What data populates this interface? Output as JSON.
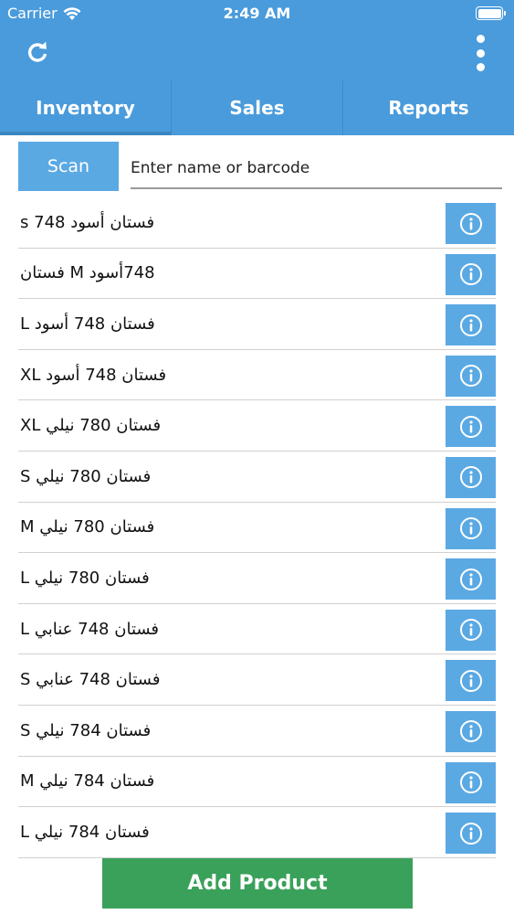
{
  "status_bar": {
    "carrier": "Carrier",
    "time": "2:49 AM"
  },
  "toolbar": {
    "refresh_icon": "refresh-icon",
    "menu_icon": "more-vertical-icon"
  },
  "tabs": [
    {
      "label": "Inventory",
      "active": true
    },
    {
      "label": "Sales",
      "active": false
    },
    {
      "label": "Reports",
      "active": false
    }
  ],
  "search": {
    "scan_label": "Scan",
    "placeholder": "Enter name or barcode",
    "value": ""
  },
  "products": [
    {
      "label": "فستان  أسود  748 s"
    },
    {
      "label": "748أسود  M فستان"
    },
    {
      "label": "فستان 748 أسود L"
    },
    {
      "label": "فستان 748 أسود  XL"
    },
    {
      "label": "فستان 780 نيلي  XL"
    },
    {
      "label": "فستان 780 نيلي  S"
    },
    {
      "label": "فستان 780 نيلي  M"
    },
    {
      "label": "فستان 780 نيلي  L"
    },
    {
      "label": "فستان 748 عنابي  L"
    },
    {
      "label": "فستان 748 عنابي  S"
    },
    {
      "label": "فستان 784 نيلي   S"
    },
    {
      "label": "فستان 784 نيلي   M"
    },
    {
      "label": "فستان 784 نيلي L"
    }
  ],
  "actions": {
    "add_product_label": "Add Product"
  },
  "colors": {
    "header": "#4a9bdb",
    "button_blue": "#5aa9e3",
    "add_button": "#3aa15a"
  }
}
